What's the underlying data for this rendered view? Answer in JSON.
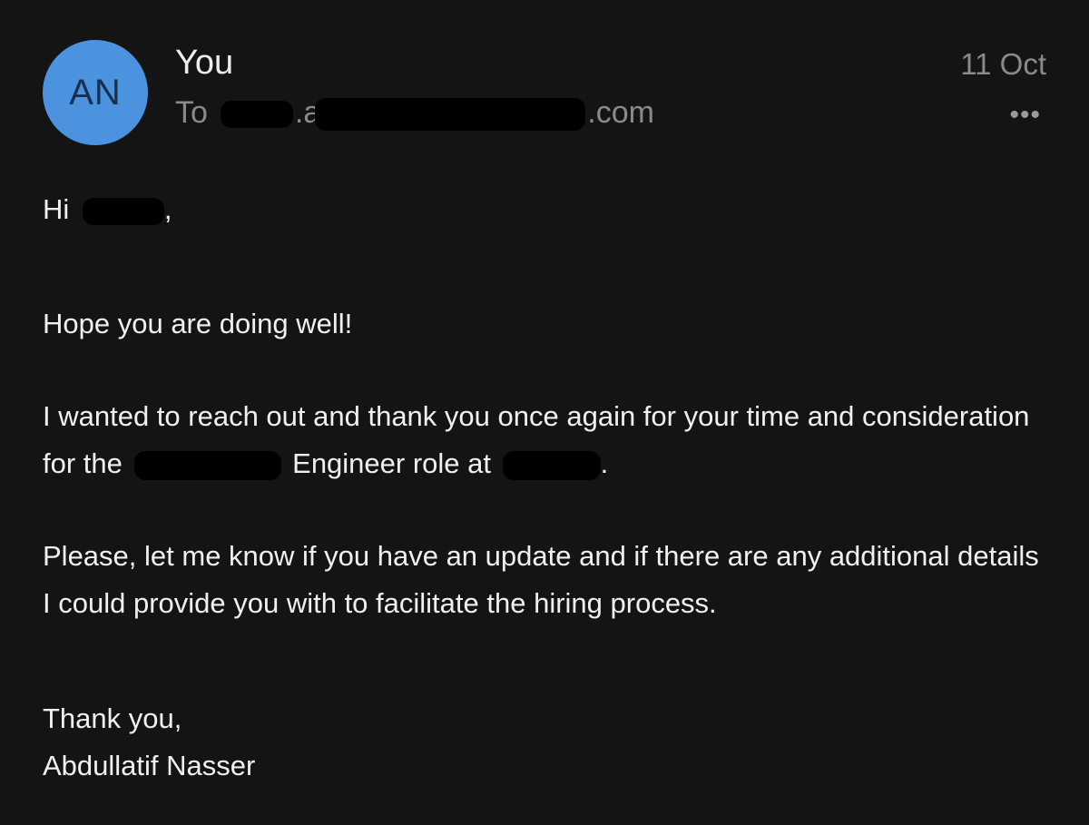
{
  "header": {
    "avatar_initials": "AN",
    "sender": "You",
    "recipient_prefix": "To",
    "recipient_visible_1": ".a",
    "recipient_visible_2": ".com",
    "date": "11 Oct",
    "more_label": "•••"
  },
  "body": {
    "greeting_start": "Hi",
    "greeting_end": ",",
    "line1": "Hope you are doing well!",
    "para2_a": "I wanted to reach out and thank you once again for your time and consideration for the",
    "para2_b": "Engineer role at",
    "para2_c": ".",
    "para3": "Please, let me know if you have an update and if there are any additional details I could provide you with to facilitate the hiring process.",
    "signoff": "Thank you,",
    "signature": "Abdullatif Nasser"
  },
  "colors": {
    "background": "#141414",
    "avatar": "#4b93de",
    "secondary_text": "#8a8a8a",
    "redaction": "#000000"
  }
}
